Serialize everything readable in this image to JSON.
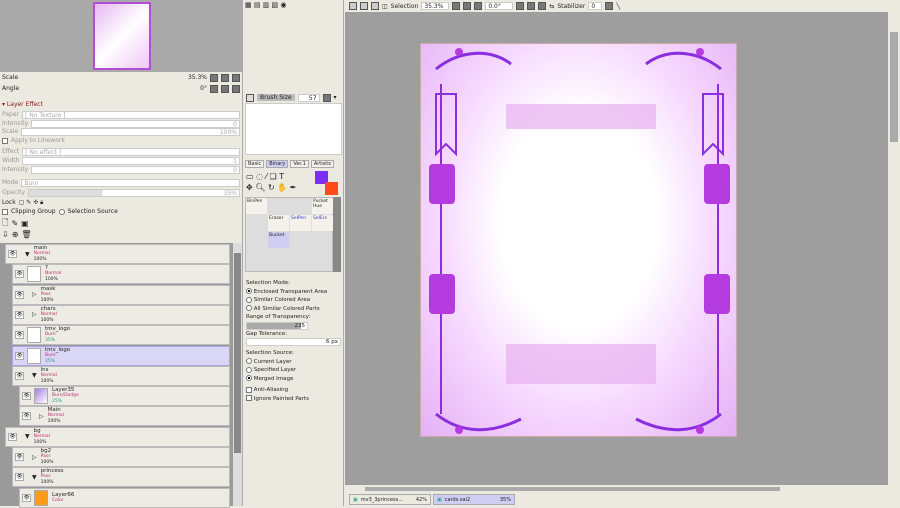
{
  "navigator": {
    "scale_label": "Scale",
    "scale_value": "35.3%",
    "angle_label": "Angle",
    "angle_value": "0°"
  },
  "layer_effect": {
    "title": "Layer Effect",
    "paper_label": "Paper",
    "paper_value": "[ No Texture ]",
    "intensity_label": "Intensity",
    "intensity_value": "0",
    "scale_label": "Scale",
    "scale_value": "100%",
    "apply_lineart": "Apply to Linework",
    "effect_label": "Effect",
    "effect_value": "[ No effect ]",
    "width_label": "Width",
    "width_value": "1",
    "intensity2_label": "Intensity",
    "intensity2_value": "0"
  },
  "layer_props": {
    "mode_label": "Mode",
    "mode_value": "Burn",
    "opacity_label": "Opacity",
    "opacity_value": "35%",
    "opacity_fraction": 0.35,
    "lock_label": "Lock",
    "clipping_group": "Clipping Group",
    "selection_source": "Selection Source"
  },
  "layers": [
    {
      "name": "main",
      "mode": "Normal",
      "opacity": "100%",
      "type": "folder",
      "indent": 0
    },
    {
      "name": "?",
      "mode": "Normal",
      "opacity": "100%",
      "type": "layer",
      "indent": 1
    },
    {
      "name": "mask",
      "mode": "Pass",
      "opacity": "100%",
      "type": "folder-closed",
      "indent": 1
    },
    {
      "name": "chars",
      "mode": "Normal",
      "opacity": "100%",
      "type": "folder-closed",
      "indent": 1
    },
    {
      "name": "tmv_logo",
      "mode": "Burn",
      "opacity": "35%",
      "type": "layer",
      "indent": 1
    },
    {
      "name": "tmv_logo",
      "mode": "Burn",
      "opacity": "35%",
      "type": "layer",
      "indent": 1,
      "selected": true
    },
    {
      "name": "lns",
      "mode": "Normal",
      "opacity": "100%",
      "type": "folder",
      "indent": 1
    },
    {
      "name": "Layer35",
      "mode": "Burn/Dodge",
      "opacity": "25%",
      "type": "layer",
      "indent": 2
    },
    {
      "name": "Main",
      "mode": "Normal",
      "opacity": "100%",
      "type": "folder-closed",
      "indent": 2
    },
    {
      "name": "bg",
      "mode": "Normal",
      "opacity": "100%",
      "type": "folder",
      "indent": 0
    },
    {
      "name": "bg2",
      "mode": "Pass",
      "opacity": "100%",
      "type": "folder-closed",
      "indent": 1
    },
    {
      "name": "princess",
      "mode": "Pass",
      "opacity": "100%",
      "type": "folder",
      "indent": 1
    },
    {
      "name": "Layer66",
      "mode": "Color",
      "opacity": "",
      "type": "layer",
      "indent": 2
    }
  ],
  "brush": {
    "size_label": "Brush Size",
    "size_value": "57"
  },
  "tool_tabs": [
    "Basic",
    "Binary",
    "Ver.1",
    "Artistic"
  ],
  "colors": {
    "primary": "#7b2ff0",
    "secondary": "#ff4a1c"
  },
  "tool_slots": [
    "BinPen",
    "Pucket Hue",
    "Eraser",
    "SelPen",
    "SelErs",
    "Bucket"
  ],
  "bucket": {
    "selection_mode_label": "Selection Mode:",
    "modes": [
      "Enclosed Transparent Area",
      "Similar Colored Area",
      "All Similar Colored Parts"
    ],
    "range_label": "Range of Transparency:",
    "range_value": "235",
    "gap_label": "Gap Tolerance:",
    "gap_value": "6 px",
    "source_label": "Selection Source:",
    "sources": [
      "Current Layer",
      "Specified Layer",
      "Merged Image"
    ],
    "anti_aliasing": "Anti-Aliasing",
    "ignore_painted": "Ignore Painted Parts"
  },
  "toolbar": {
    "selection_label": "Selection",
    "zoom": "35.3%",
    "angle": "0.0°",
    "stabilizer_label": "Stabilizer",
    "stabilizer_value": "0"
  },
  "tabs": [
    {
      "name": "mv3_3princess...",
      "zoom": "42%"
    },
    {
      "name": "cards.sai2",
      "zoom": "35%",
      "active": true
    }
  ]
}
